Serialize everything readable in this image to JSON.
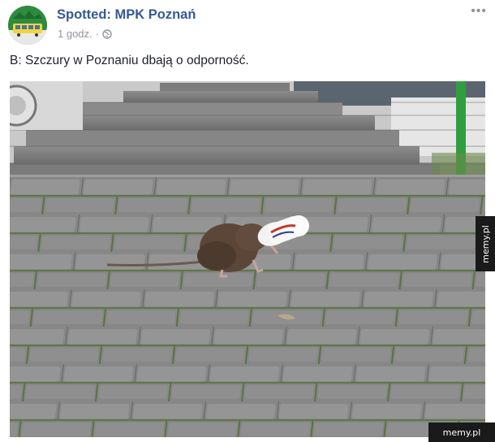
{
  "post": {
    "page_name": "Spotted: MPK Poznań",
    "timestamp": "1 godz.",
    "separator": "·",
    "more_label": "•••",
    "text": "B: Szczury w Poznaniu dbają o odporność.",
    "photo_icon": "rat-with-bottle-photo"
  },
  "watermarks": {
    "side": "memy.pl",
    "corner": "memy.pl"
  },
  "colors": {
    "link_blue": "#365899",
    "meta_gray": "#90949c",
    "text": "#1d2129"
  }
}
